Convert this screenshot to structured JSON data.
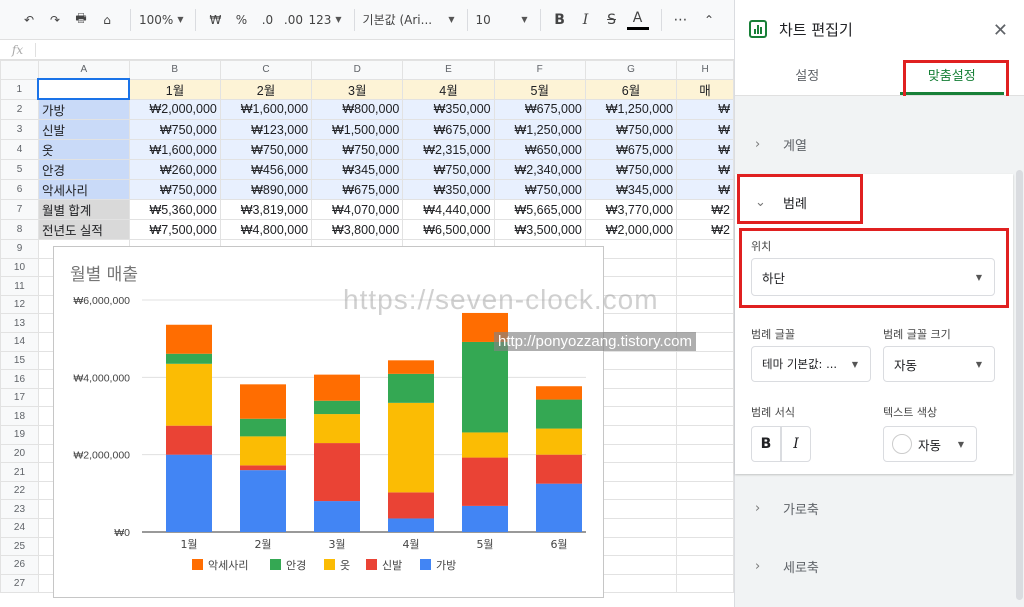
{
  "toolbar": {
    "zoom": "100%",
    "currency": "₩",
    "percent": "%",
    "dec_less": ".0",
    "dec_more": ".00",
    "num_format": "123",
    "font": "기본값 (Ari...",
    "font_size": "10",
    "bold": "B",
    "italic": "I",
    "strike": "S",
    "text_color": "A",
    "more": "⋯"
  },
  "formula_bar": {
    "fx": "fx",
    "value": ""
  },
  "sheet": {
    "columns": [
      "A",
      "B",
      "C",
      "D",
      "E",
      "F",
      "G",
      "H"
    ],
    "rows": [
      "1",
      "2",
      "3",
      "4",
      "5",
      "6",
      "7",
      "8",
      "9",
      "10",
      "11",
      "12",
      "13",
      "14",
      "15",
      "16",
      "17",
      "18",
      "19",
      "20",
      "21",
      "22",
      "23",
      "24",
      "25",
      "26",
      "27"
    ],
    "header": [
      "",
      "1월",
      "2월",
      "3월",
      "4월",
      "5월",
      "6월",
      "매"
    ],
    "data": [
      [
        "가방",
        "₩2,000,000",
        "₩1,600,000",
        "₩800,000",
        "₩350,000",
        "₩675,000",
        "₩1,250,000",
        "₩"
      ],
      [
        "신발",
        "₩750,000",
        "₩123,000",
        "₩1,500,000",
        "₩675,000",
        "₩1,250,000",
        "₩750,000",
        "₩"
      ],
      [
        "옷",
        "₩1,600,000",
        "₩750,000",
        "₩750,000",
        "₩2,315,000",
        "₩650,000",
        "₩675,000",
        "₩"
      ],
      [
        "안경",
        "₩260,000",
        "₩456,000",
        "₩345,000",
        "₩750,000",
        "₩2,340,000",
        "₩750,000",
        "₩"
      ],
      [
        "악세사리",
        "₩750,000",
        "₩890,000",
        "₩675,000",
        "₩350,000",
        "₩750,000",
        "₩345,000",
        "₩"
      ],
      [
        "월별 합계",
        "₩5,360,000",
        "₩3,819,000",
        "₩4,070,000",
        "₩4,440,000",
        "₩5,665,000",
        "₩3,770,000",
        "₩2"
      ],
      [
        "전년도 실적",
        "₩7,500,000",
        "₩4,800,000",
        "₩3,800,000",
        "₩6,500,000",
        "₩3,500,000",
        "₩2,000,000",
        "₩2"
      ]
    ]
  },
  "chart_data": {
    "type": "bar",
    "stacked": true,
    "title": "월별 매출",
    "categories": [
      "1월",
      "2월",
      "3월",
      "4월",
      "5월",
      "6월"
    ],
    "ylim": [
      0,
      6000000
    ],
    "yticks": [
      "₩0",
      "₩2,000,000",
      "₩4,000,000",
      "₩6,000,000"
    ],
    "legend_position": "bottom",
    "series": [
      {
        "name": "가방",
        "color": "#4285f4",
        "values": [
          2000000,
          1600000,
          800000,
          350000,
          675000,
          1250000
        ]
      },
      {
        "name": "신발",
        "color": "#ea4335",
        "values": [
          750000,
          123000,
          1500000,
          675000,
          1250000,
          750000
        ]
      },
      {
        "name": "옷",
        "color": "#fbbc04",
        "values": [
          1600000,
          750000,
          750000,
          2315000,
          650000,
          675000
        ]
      },
      {
        "name": "안경",
        "color": "#34a853",
        "values": [
          260000,
          456000,
          345000,
          750000,
          2340000,
          750000
        ]
      },
      {
        "name": "악세사리",
        "color": "#ff6d01",
        "values": [
          750000,
          890000,
          675000,
          350000,
          750000,
          345000
        ]
      }
    ],
    "legend_order": [
      "악세사리",
      "안경",
      "옷",
      "신발",
      "가방"
    ]
  },
  "watermarks": {
    "primary": "https://seven-clock.com",
    "secondary": "http://ponyozzang.tistory.com"
  },
  "panel": {
    "title": "차트 편집기",
    "tab_setup": "설정",
    "tab_customize": "맞춤설정",
    "section_series": "계열",
    "section_legend": "범례",
    "position_label": "위치",
    "position_value": "하단",
    "legend_font_label": "범례 글꼴",
    "legend_font_value": "테마 기본값: ...",
    "legend_size_label": "범례 글꼴 크기",
    "legend_size_value": "자동",
    "legend_format_label": "범례 서식",
    "bold": "B",
    "italic": "I",
    "text_color_label": "텍스트 색상",
    "text_color_value": "자동",
    "section_haxis": "가로축",
    "section_vaxis": "세로축"
  }
}
